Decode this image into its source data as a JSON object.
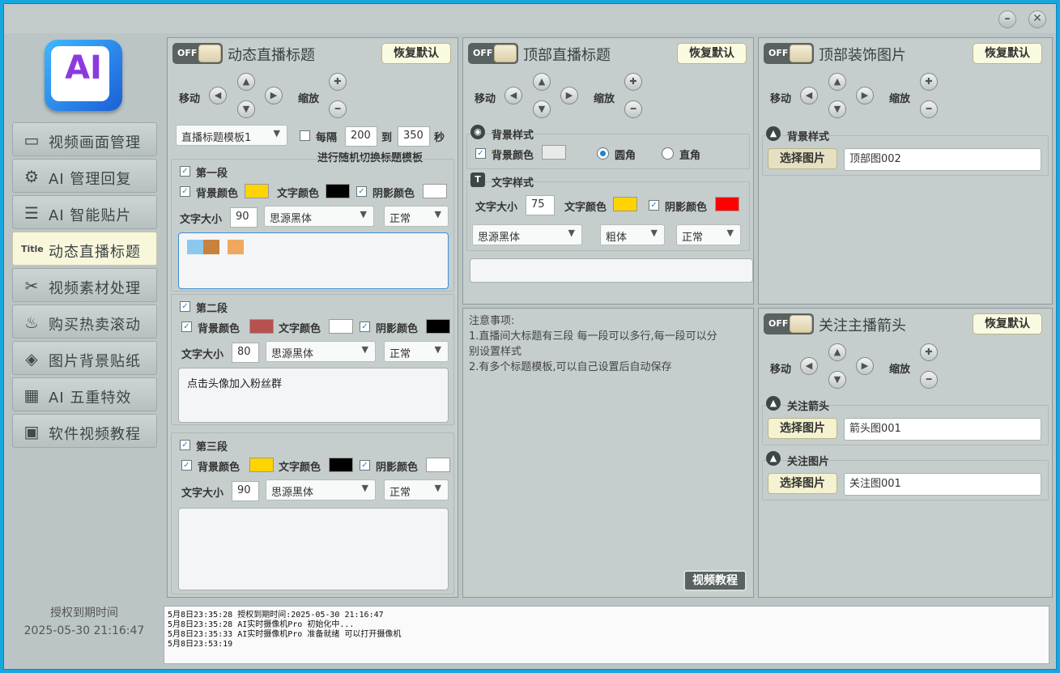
{
  "window": {
    "minimize_icon": "minus-circle-icon",
    "close_icon": "close-circle-icon"
  },
  "sidebar": {
    "logo_text": "AI",
    "items": [
      {
        "label": "视频画面管理",
        "icon": "tv-icon"
      },
      {
        "label": "AI 管理回复",
        "icon": "user-gear-icon"
      },
      {
        "label": "AI 智能贴片",
        "icon": "sticker-icon"
      },
      {
        "label": "动态直播标题",
        "icon": "title-icon"
      },
      {
        "label": "视频素材处理",
        "icon": "scissors-icon"
      },
      {
        "label": "购买热卖滚动",
        "icon": "hot-fire-icon"
      },
      {
        "label": "图片背景贴纸",
        "icon": "tag-icon"
      },
      {
        "label": "AI 五重特效",
        "icon": "grid-icon"
      },
      {
        "label": "软件视频教程",
        "icon": "tutorial-icon"
      }
    ],
    "expire_label": "授权到期时间",
    "expire_value": "2025-05-30 21:16:47"
  },
  "common": {
    "off": "OFF",
    "reset": "恢复默认",
    "move": "移动",
    "zoom": "缩放",
    "bg_color": "背景颜色",
    "text_color": "文字颜色",
    "shadow_color": "阴影颜色",
    "font_size": "文字大小",
    "font": "思源黑体",
    "normal": "正常",
    "choose_image": "选择图片"
  },
  "panel1": {
    "title": "动态直播标题",
    "template": "直播标题模板1",
    "interval_label": "每隔",
    "interval_from": "200",
    "to_label": "到",
    "interval_to": "350",
    "sec_label": "秒",
    "random_label": "进行随机切换标题模板",
    "seg1": {
      "title": "第一段",
      "size": "90",
      "bg": "#ffd400",
      "text": "#000000",
      "shadow": "#ffffff",
      "content": ""
    },
    "seg2": {
      "title": "第二段",
      "size": "80",
      "bg": "#b5514f",
      "text": "#ffffff",
      "shadow": "#000000",
      "content": "点击头像加入粉丝群"
    },
    "seg3": {
      "title": "第三段",
      "size": "90",
      "bg": "#ffd400",
      "text": "#000000",
      "shadow": "#ffffff",
      "content": ""
    }
  },
  "panel2": {
    "title": "顶部直播标题",
    "bg_style": "背景样式",
    "bg_color_val": "#e8eaea",
    "round": "圆角",
    "square": "直角",
    "text_style": "文字样式",
    "size": "75",
    "text_color_val": "#ffd400",
    "shadow_color_val": "#ff0000",
    "weight": "粗体"
  },
  "panel3": {
    "title": "顶部装饰图片",
    "bg_style": "背景样式",
    "image_name": "顶部图002"
  },
  "panel4": {
    "title": "关注主播箭头",
    "arrow_label": "关注箭头",
    "arrow_image": "箭头图001",
    "follow_label": "关注图片",
    "follow_image": "关注图001"
  },
  "notes": {
    "lines": [
      "注意事项:",
      "1.直播间大标题有三段 每一段可以多行,每一段可以分",
      "别设置样式",
      "2.有多个标题模板,可以自己设置后自动保存"
    ],
    "video_btn": "视频教程"
  },
  "log": {
    "lines": [
      "5月8日23:35:28 授权到期时间:2025-05-30 21:16:47",
      "5月8日23:35:28 AI实时摄像机Pro 初始化中...",
      "5月8日23:35:33 AI实时摄像机Pro 准备就绪 可以打开摄像机",
      "5月8日23:53:19"
    ]
  }
}
